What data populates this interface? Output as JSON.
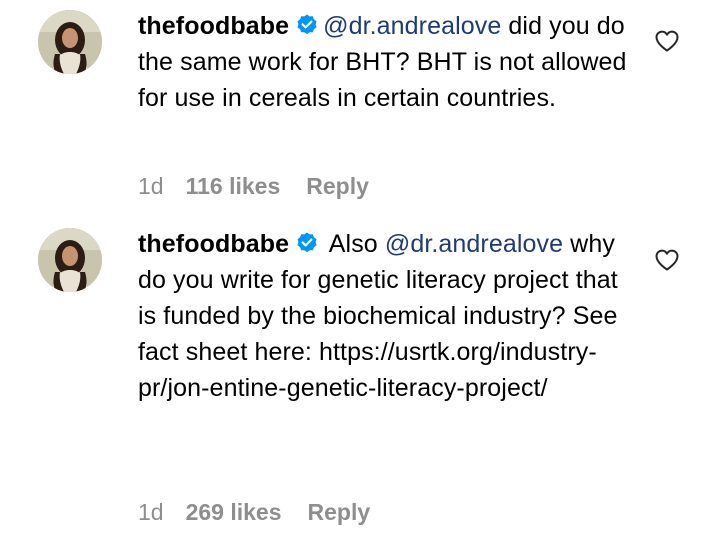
{
  "comments": [
    {
      "username": "thefoodbabe",
      "mention": "@dr.andrealove",
      "lead": "",
      "text": " did you do the same work for BHT? BHT is not allowed for use in cereals in certain countries.",
      "time": "1d",
      "likes": "116 likes",
      "reply": "Reply",
      "verified_icon": "verified-badge-icon",
      "like_icon": "heart-outline-icon"
    },
    {
      "username": "thefoodbabe",
      "lead": " Also ",
      "mention": "@dr.andrealove",
      "text": " why do you write for genetic literacy project that is funded by the biochemical industry? See fact sheet here: https://usrtk.org/industry-pr/jon-entine-genetic-literacy-project/",
      "time": "1d",
      "likes": "269 likes",
      "reply": "Reply",
      "verified_icon": "verified-badge-icon",
      "like_icon": "heart-outline-icon"
    }
  ],
  "colors": {
    "mention": "#1f3a74",
    "verified": "#0095f6",
    "meta": "#8e8e8e"
  }
}
